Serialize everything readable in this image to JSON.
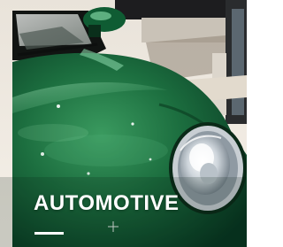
{
  "tile": {
    "caption": "AUTOMOTIVE"
  },
  "colors": {
    "paint_dark": "#0b4a2a",
    "paint_mid": "#1f7a45",
    "paint_light": "#4fb779",
    "floor": "#f1ebe2",
    "chrome": "#d9dee3",
    "caption_text": "#ffffff"
  }
}
